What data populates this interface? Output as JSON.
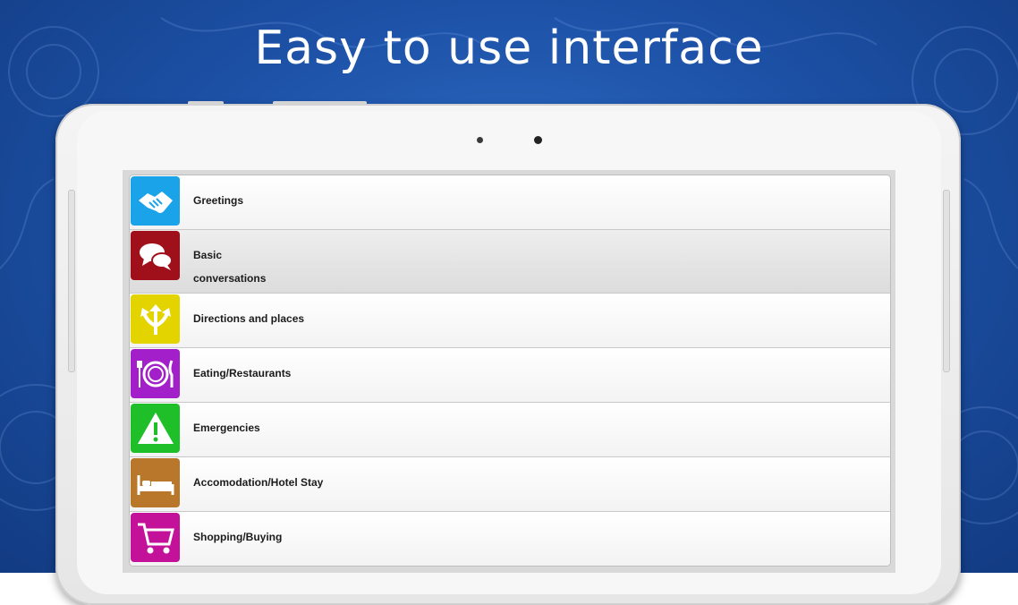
{
  "headline": "Easy to use interface",
  "menu": {
    "items": [
      {
        "label": "Greetings",
        "icon": "handshake-icon",
        "color": "#1aa3e8"
      },
      {
        "label": "Basic\nconversations",
        "icon": "speech-bubbles-icon",
        "color": "#a0101a"
      },
      {
        "label": "Directions and places",
        "icon": "directions-arrows-icon",
        "color": "#e3d400"
      },
      {
        "label": "Eating/Restaurants",
        "icon": "plate-cutlery-icon",
        "color": "#a21fc9"
      },
      {
        "label": "Emergencies",
        "icon": "warning-icon",
        "color": "#1fbf2a"
      },
      {
        "label": "Accomodation/Hotel Stay",
        "icon": "bed-icon",
        "color": "#b8772a"
      },
      {
        "label": "Shopping/Buying",
        "icon": "cart-icon",
        "color": "#c3119a"
      }
    ]
  }
}
